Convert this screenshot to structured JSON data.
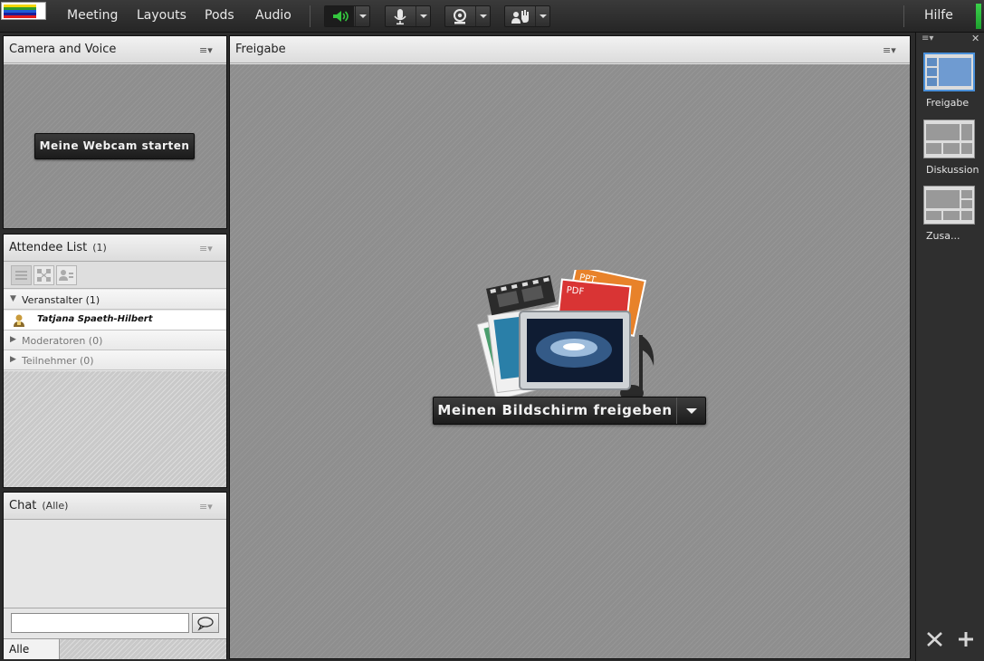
{
  "menu": {
    "meeting": "Meeting",
    "layouts": "Layouts",
    "pods": "Pods",
    "audio": "Audio",
    "help": "Hilfe"
  },
  "colors": {
    "speaker_active": "#34c63e",
    "selection_blue": "#4a90d9",
    "audio_level": "#2cc23a"
  },
  "icons": {
    "speaker": "speaker-icon",
    "microphone": "microphone-icon",
    "webcam": "webcam-icon",
    "raise_hand": "raise-hand-icon"
  },
  "camera_pod": {
    "title": "Camera and Voice",
    "start_webcam_label": "Meine Webcam starten"
  },
  "attendee_pod": {
    "title": "Attendee List",
    "count": "(1)",
    "groups": [
      {
        "label": "Veranstalter (1)",
        "expanded": true
      },
      {
        "label": "Moderatoren (0)",
        "expanded": false
      },
      {
        "label": "Teilnehmer (0)",
        "expanded": false
      }
    ],
    "attendees": [
      {
        "name": "Tatjana Spaeth-Hilbert"
      }
    ]
  },
  "chat_pod": {
    "title": "Chat",
    "scope": "(Alle)",
    "input_value": "",
    "tab_label": "Alle"
  },
  "share_pod": {
    "title": "Freigabe",
    "share_screen_label": "Meinen Bildschirm freigeben",
    "ppt_label": "PPT",
    "pdf_label": "PDF"
  },
  "layouts_panel": {
    "items": [
      {
        "label": "Freigabe",
        "selected": true
      },
      {
        "label": "Diskussion",
        "selected": false
      },
      {
        "label": "Zusa...",
        "selected": false
      }
    ]
  }
}
